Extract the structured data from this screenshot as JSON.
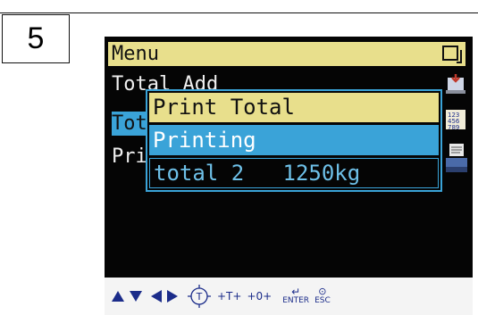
{
  "step_number": "5",
  "screen": {
    "menu_title": "Menu",
    "menu_items": [
      {
        "label": "Total Add"
      },
      {
        "label": "Total"
      },
      {
        "label": "Print"
      }
    ],
    "dialog": {
      "title": "Print Total",
      "status": "Printing",
      "total_line": "total 2   1250kg"
    },
    "side_icons": [
      "scale-icon",
      "keypad-icon",
      "printer-icon"
    ],
    "footer_keys": {
      "up": "up-arrow-icon",
      "down": "down-arrow-icon",
      "left": "left-arrow-icon",
      "right": "right-arrow-icon",
      "tare_circle_label": "T",
      "tare_label": "+T+",
      "zero_label": "+0+",
      "enter_label": "ENTER",
      "esc_label": "ESC"
    },
    "colors": {
      "menu_bar": "#e8df8c",
      "selection": "#3aa3d8",
      "background": "#050505",
      "footer_icons": "#1b2c8a"
    }
  }
}
